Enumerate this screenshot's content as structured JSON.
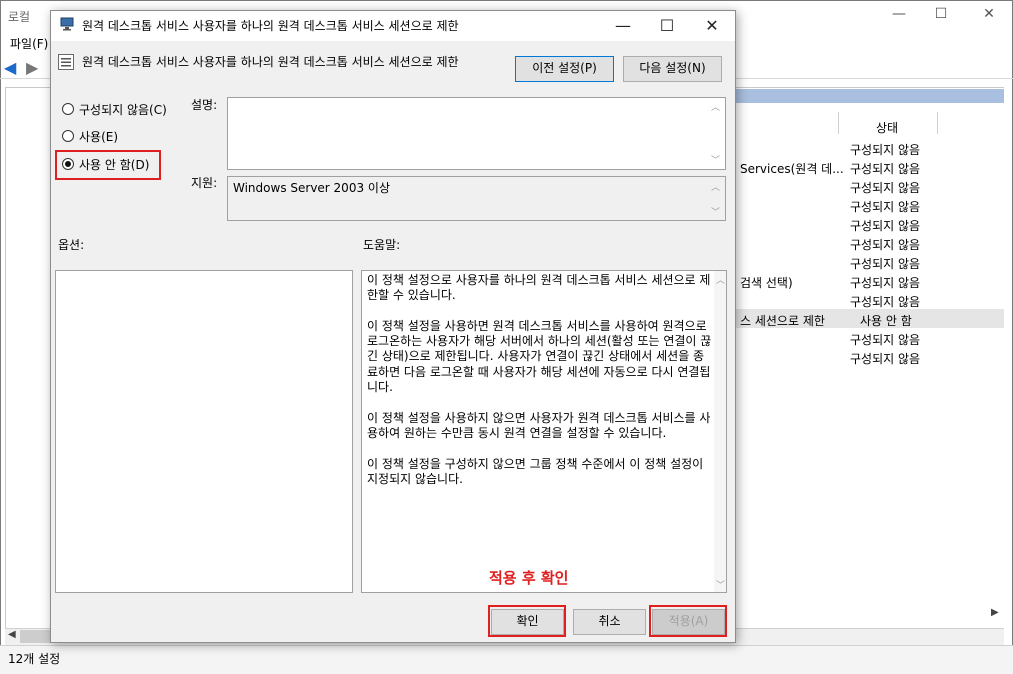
{
  "background_window": {
    "title": "로컬",
    "menu_file": "파일(F)",
    "column_state": "상태",
    "rows": [
      {
        "name": "",
        "state": "구성되지 않음"
      },
      {
        "name": "Services(원격 데...",
        "state": "구성되지 않음"
      },
      {
        "name": "",
        "state": "구성되지 않음"
      },
      {
        "name": "",
        "state": "구성되지 않음"
      },
      {
        "name": "",
        "state": "구성되지 않음"
      },
      {
        "name": "",
        "state": "구성되지 않음"
      },
      {
        "name": "",
        "state": "구성되지 않음"
      },
      {
        "name": "검색 선택)",
        "state": "구성되지 않음"
      },
      {
        "name": "",
        "state": "구성되지 않음"
      },
      {
        "name": "스 세션으로 제한",
        "state": "사용 안 함"
      },
      {
        "name": "",
        "state": "구성되지 않음"
      },
      {
        "name": "",
        "state": "구성되지 않음"
      }
    ],
    "status": "12개 설정",
    "controls": {
      "minimize": "—",
      "maximize": "☐",
      "close": "✕"
    }
  },
  "dialog": {
    "title": "원격 데스크톱 서비스 사용자를 하나의 원격 데스크톱 서비스 세션으로 제한",
    "controls": {
      "minimize": "—",
      "maximize": "☐",
      "close": "✕"
    },
    "policy_name": "원격 데스크톱 서비스 사용자를 하나의 원격 데스크톱 서비스 세션으로 제한",
    "prev_button": "이전 설정(P)",
    "next_button": "다음 설정(N)",
    "radio_not_configured": "구성되지 않음(C)",
    "radio_enabled": "사용(E)",
    "radio_disabled": "사용 안 함(D)",
    "selected_option": "disabled",
    "description_label": "설명:",
    "description_value": "",
    "supported_label": "지원:",
    "supported_value": "Windows Server 2003 이상",
    "options_label": "옵션:",
    "help_label": "도움말:",
    "help_text": "이 정책 설정으로 사용자를 하나의 원격 데스크톱 서비스 세션으로 제한할 수 있습니다.\n\n이 정책 설정을 사용하면 원격 데스크톱 서비스를 사용하여 원격으로 로그온하는 사용자가 해당 서버에서 하나의 세션(활성 또는 연결이 끊긴 상태)으로 제한됩니다. 사용자가 연결이 끊긴 상태에서 세션을 종료하면 다음 로그온할 때 사용자가 해당 세션에 자동으로 다시 연결됩니다.\n\n이 정책 설정을 사용하지 않으면 사용자가 원격 데스크톱 서비스를 사용하여 원하는 수만큼 동시 원격 연결을 설정할 수 있습니다.\n\n이 정책 설정을 구성하지 않으면 그룹 정책 수준에서 이 정책 설정이 지정되지 않습니다.",
    "ok_button": "확인",
    "cancel_button": "취소",
    "apply_button": "적용(A)"
  },
  "annotation": "적용 후 확인",
  "colors": {
    "highlight_red": "#e02020",
    "accent_blue": "#0078d7"
  }
}
